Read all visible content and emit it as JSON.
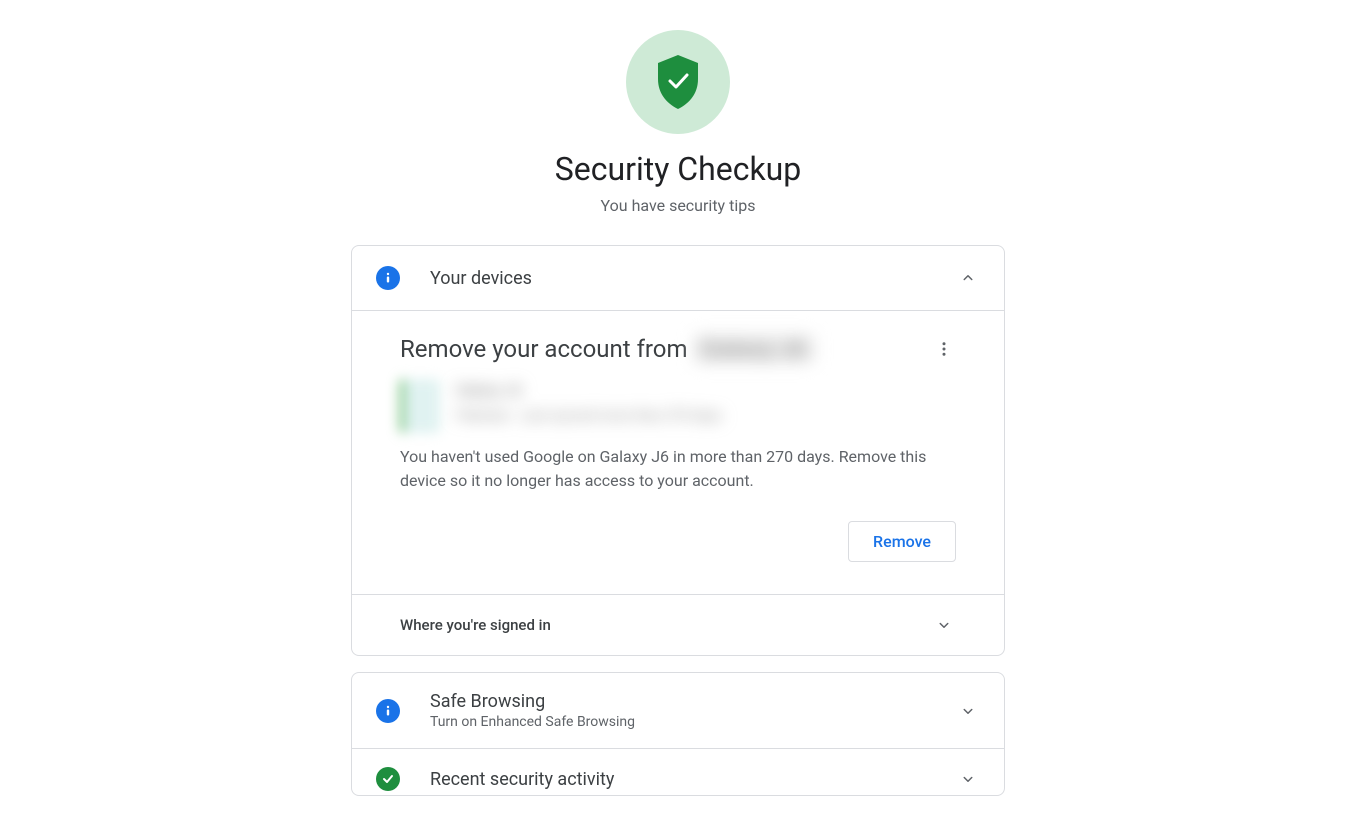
{
  "header": {
    "title": "Security Checkup",
    "subtitle": "You have security tips"
  },
  "devices_section": {
    "title": "Your devices",
    "expanded": true,
    "detail": {
      "heading_prefix": "Remove your account from",
      "heading_device_blurred": "Galaxy J6",
      "device_name_blurred": "Galaxy J6",
      "device_meta_blurred": "Pakistan · Last synced more than 270 days",
      "description": "You haven't used Google on Galaxy J6 in more than 270 days. Remove this device so it no longer has access to your account.",
      "remove_label": "Remove"
    },
    "subsection": {
      "title": "Where you're signed in"
    }
  },
  "safe_browsing_section": {
    "title": "Safe Browsing",
    "subtitle": "Turn on Enhanced Safe Browsing"
  },
  "recent_activity_section": {
    "title": "Recent security activity"
  }
}
